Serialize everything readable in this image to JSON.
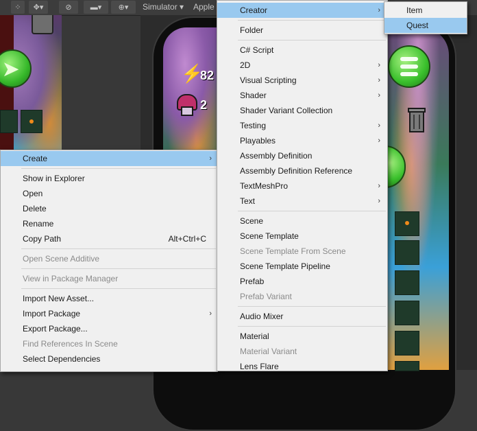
{
  "toolbar": {
    "simulator_label": "Simulator",
    "device_label": "Apple"
  },
  "scene": {
    "counter_energy": "82",
    "counter_mushroom": "2"
  },
  "context_menu": {
    "items": [
      {
        "label": "Create",
        "submenu": true,
        "highlighted": true
      },
      {
        "label": "Show in Explorer"
      },
      {
        "label": "Open"
      },
      {
        "label": "Delete"
      },
      {
        "label": "Rename"
      },
      {
        "label": "Copy Path",
        "shortcut": "Alt+Ctrl+C"
      },
      {
        "label": "Open Scene Additive",
        "disabled": true
      },
      {
        "label": "View in Package Manager",
        "disabled": true
      },
      {
        "label": "Import New Asset..."
      },
      {
        "label": "Import Package",
        "submenu": true
      },
      {
        "label": "Export Package..."
      },
      {
        "label": "Find References In Scene",
        "disabled": true
      },
      {
        "label": "Select Dependencies"
      }
    ]
  },
  "create_menu": {
    "items": [
      {
        "label": "Creator",
        "submenu": true,
        "highlighted": true
      },
      {
        "label": "Folder"
      },
      {
        "label": "C# Script"
      },
      {
        "label": "2D",
        "submenu": true
      },
      {
        "label": "Visual Scripting",
        "submenu": true
      },
      {
        "label": "Shader",
        "submenu": true
      },
      {
        "label": "Shader Variant Collection"
      },
      {
        "label": "Testing",
        "submenu": true
      },
      {
        "label": "Playables",
        "submenu": true
      },
      {
        "label": "Assembly Definition"
      },
      {
        "label": "Assembly Definition Reference"
      },
      {
        "label": "TextMeshPro",
        "submenu": true
      },
      {
        "label": "Text",
        "submenu": true
      },
      {
        "label": "Scene"
      },
      {
        "label": "Scene Template"
      },
      {
        "label": "Scene Template From Scene",
        "disabled": true
      },
      {
        "label": "Scene Template Pipeline"
      },
      {
        "label": "Prefab"
      },
      {
        "label": "Prefab Variant",
        "disabled": true
      },
      {
        "label": "Audio Mixer"
      },
      {
        "label": "Material"
      },
      {
        "label": "Material Variant",
        "disabled": true
      },
      {
        "label": "Lens Flare"
      }
    ]
  },
  "creator_menu": {
    "items": [
      {
        "label": "Item"
      },
      {
        "label": "Quest",
        "highlighted": true
      }
    ]
  },
  "arrow_glyph": "›",
  "icons": [
    "move-tool-icon",
    "visibility-off-icon",
    "camera-icon",
    "gizmo-icon",
    "trash-icon",
    "menu-icon",
    "play-icon",
    "lightning-icon",
    "mushroom-icon"
  ]
}
